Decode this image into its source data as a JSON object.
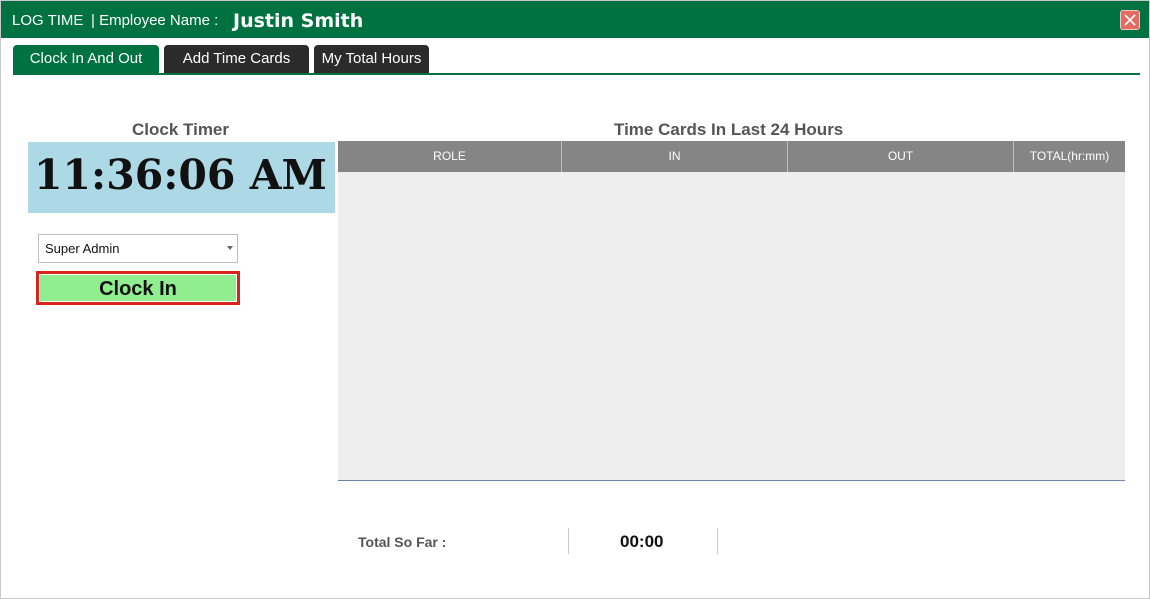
{
  "window": {
    "title": "LOG TIME",
    "employee_label": "| Employee Name :",
    "employee_name": "Justin Smith",
    "close_icon": "close-icon"
  },
  "tabs": [
    {
      "label": "Clock In And Out",
      "active": true
    },
    {
      "label": "Add Time Cards",
      "active": false
    },
    {
      "label": "My Total Hours",
      "active": false
    }
  ],
  "clock": {
    "title": "Clock Timer",
    "time": "11:36:06 AM"
  },
  "role_select": {
    "value": "Super Admin"
  },
  "clock_in_button": {
    "label": "Clock In"
  },
  "timecards": {
    "title": "Time Cards In Last 24 Hours",
    "columns": [
      "ROLE",
      "IN",
      "OUT",
      "TOTAL(hr:mm)"
    ],
    "rows": []
  },
  "totals": {
    "label": "Total So Far :",
    "value": "00:00"
  },
  "colors": {
    "accent_green": "#007140",
    "clock_panel": "#add8e6",
    "clock_in_button": "#90ee90",
    "clock_in_border": "#d9261c",
    "close_button": "#e26b63",
    "grid_header": "#858585",
    "grid_body": "#eeeeee"
  }
}
